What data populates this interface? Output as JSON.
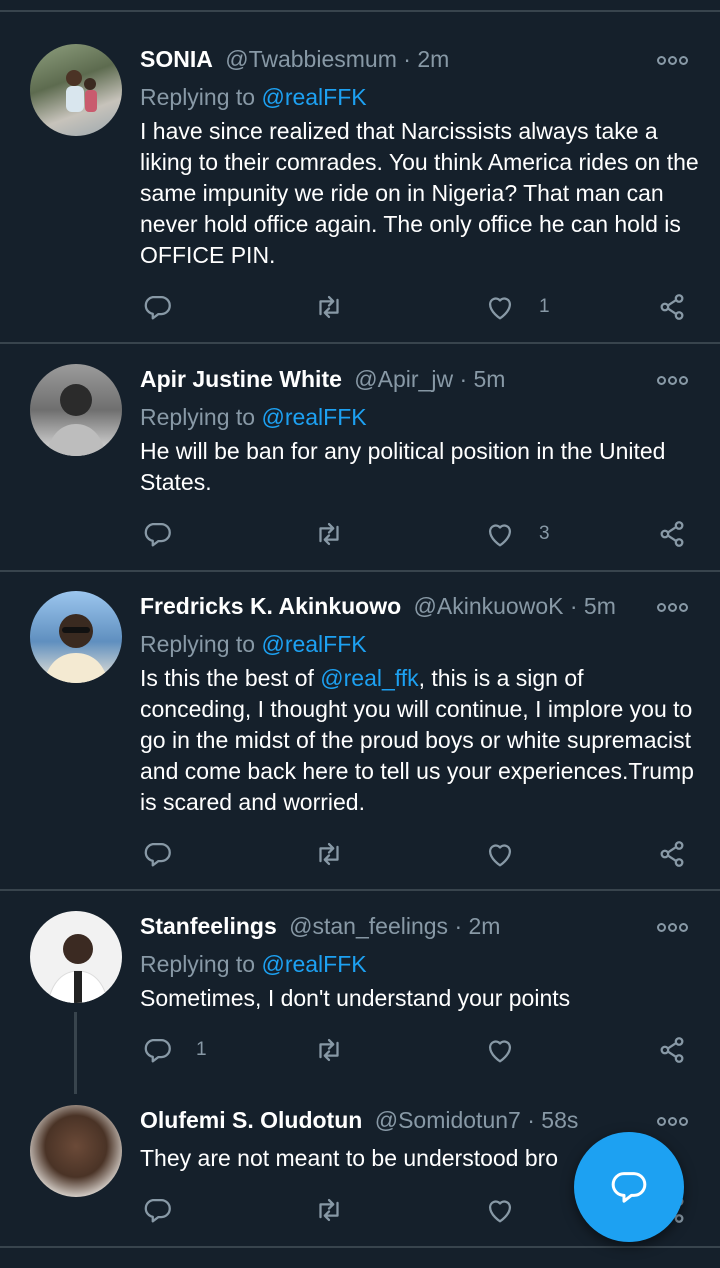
{
  "tweets": [
    {
      "name": "SONIA",
      "handle": "@Twabbiesmum",
      "time": "2m",
      "replying_prefix": "Replying to ",
      "replying_to": "@realFFK",
      "text": "I have since realized that Narcissists always take a liking to their comrades. You think America rides on the same impunity we ride on in Nigeria? That man can never hold office again. The only office he can hold is OFFICE PIN.",
      "replies": "",
      "likes": "1",
      "avatar_colors": [
        "#7a8a6e",
        "#c9c1b5"
      ]
    },
    {
      "name": "Apir Justine White",
      "handle": "@Apir_jw",
      "time": "5m",
      "replying_prefix": "Replying to ",
      "replying_to": "@realFFK",
      "text": "He will be ban for any political position in the United States.",
      "replies": "",
      "likes": "3",
      "avatar_colors": [
        "#777777",
        "#dddddd"
      ]
    },
    {
      "name": "Fredricks K. Akinkuowo",
      "handle": "@AkinkuowoK",
      "time": "5m",
      "replying_prefix": "Replying to ",
      "replying_to": "@realFFK",
      "text_parts": [
        "Is this the best of ",
        "@real_ffk",
        ", this is a sign of conceding, I thought you will continue, I implore you to go in the midst of the proud boys or white supremacist and come back here to tell us your experiences.Trump is scared and worried."
      ],
      "replies": "",
      "likes": "",
      "avatar_colors": [
        "#6fa4d6",
        "#3a2a20"
      ]
    },
    {
      "name": "Stanfeelings",
      "handle": "@stan_feelings",
      "time": "2m",
      "replying_prefix": "Replying to ",
      "replying_to": "@realFFK",
      "text": "Sometimes, I don't understand your points",
      "replies": "1",
      "likes": "",
      "avatar_colors": [
        "#f2f2f2",
        "#3b2a22"
      ]
    },
    {
      "name": "Olufemi S. Oludotun",
      "handle": "@Somidotun7",
      "time": "58s",
      "text": "They are not meant to be understood bro",
      "replies": "",
      "likes": "",
      "avatar_colors": [
        "#d8d2cc",
        "#4a3326"
      ]
    }
  ],
  "colors": {
    "background": "#15202b",
    "accent": "#1da1f2",
    "muted": "#8899a6",
    "separator": "#38444d"
  },
  "icons": [
    "reply-icon",
    "retweet-icon",
    "like-icon",
    "share-icon",
    "more-icon",
    "compose-reply-icon"
  ]
}
